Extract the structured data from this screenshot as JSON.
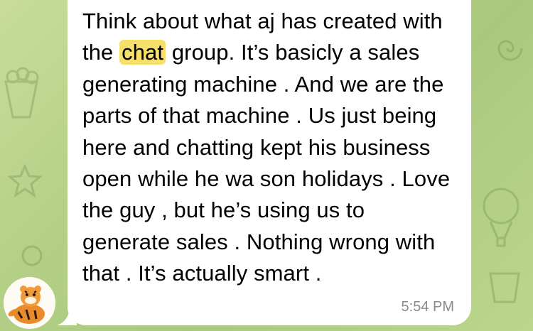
{
  "message": {
    "text_before": "Think about what aj has created with the ",
    "highlight": "chat",
    "text_after": " group. It’s basicly a sales generating machine . And we are the parts of that machine . Us just being here and chatting kept his business open while he wa son holidays . Love the guy , but he’s using us to generate sales . Nothing wrong with that . It’s actually smart .",
    "timestamp": "5:54 PM"
  },
  "sender": {
    "avatar_icon": "tiger-avatar-icon"
  },
  "colors": {
    "highlight": "#f4e06a",
    "bubble": "#ffffff",
    "timestamp": "#8a8a8e",
    "wallpaper": "#b3cf86"
  }
}
